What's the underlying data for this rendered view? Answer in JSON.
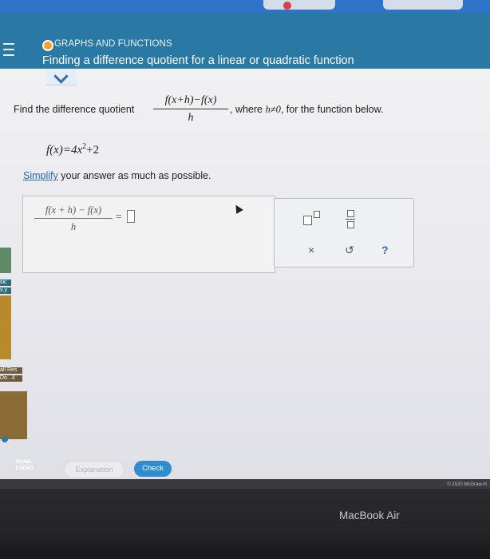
{
  "header": {
    "category": "GRAPHS AND FUNCTIONS",
    "title": "Finding a difference quotient for a linear or quadratic function"
  },
  "problem": {
    "prompt_prefix": "Find the difference quotient",
    "quotient_numerator": "f(x+h)−f(x)",
    "quotient_denominator": "h",
    "prompt_suffix_a": ", where ",
    "condition": "h≠0",
    "prompt_suffix_b": ", for the function below.",
    "function_text": "f(x)=4x",
    "function_exponent": "2",
    "function_tail": "+2",
    "simplify_link": "Simplify",
    "simplify_rest": " your answer as much as possible."
  },
  "answer": {
    "numerator": "f(x + h) − f(x)",
    "denominator": "h",
    "equals": "="
  },
  "toolbar": {
    "clear_symbol": "×",
    "undo_symbol": "↺",
    "help_symbol": "?"
  },
  "actions": {
    "explanation_label": "Explanation",
    "check_label": "Check"
  },
  "footer": {
    "copyright": "© 2020 McGraw-H",
    "device_label": "MacBook Air"
  },
  "sidebar_fragments": {
    "a": "sic",
    "b": "x.y",
    "c": "all Res",
    "d": "Do...4",
    "e": "Instal",
    "f": "LockD"
  },
  "colors": {
    "header_bg": "#2a79a5",
    "status_dot": "#f3a12d",
    "check_button": "#2f8ccf",
    "link": "#2968a8"
  }
}
